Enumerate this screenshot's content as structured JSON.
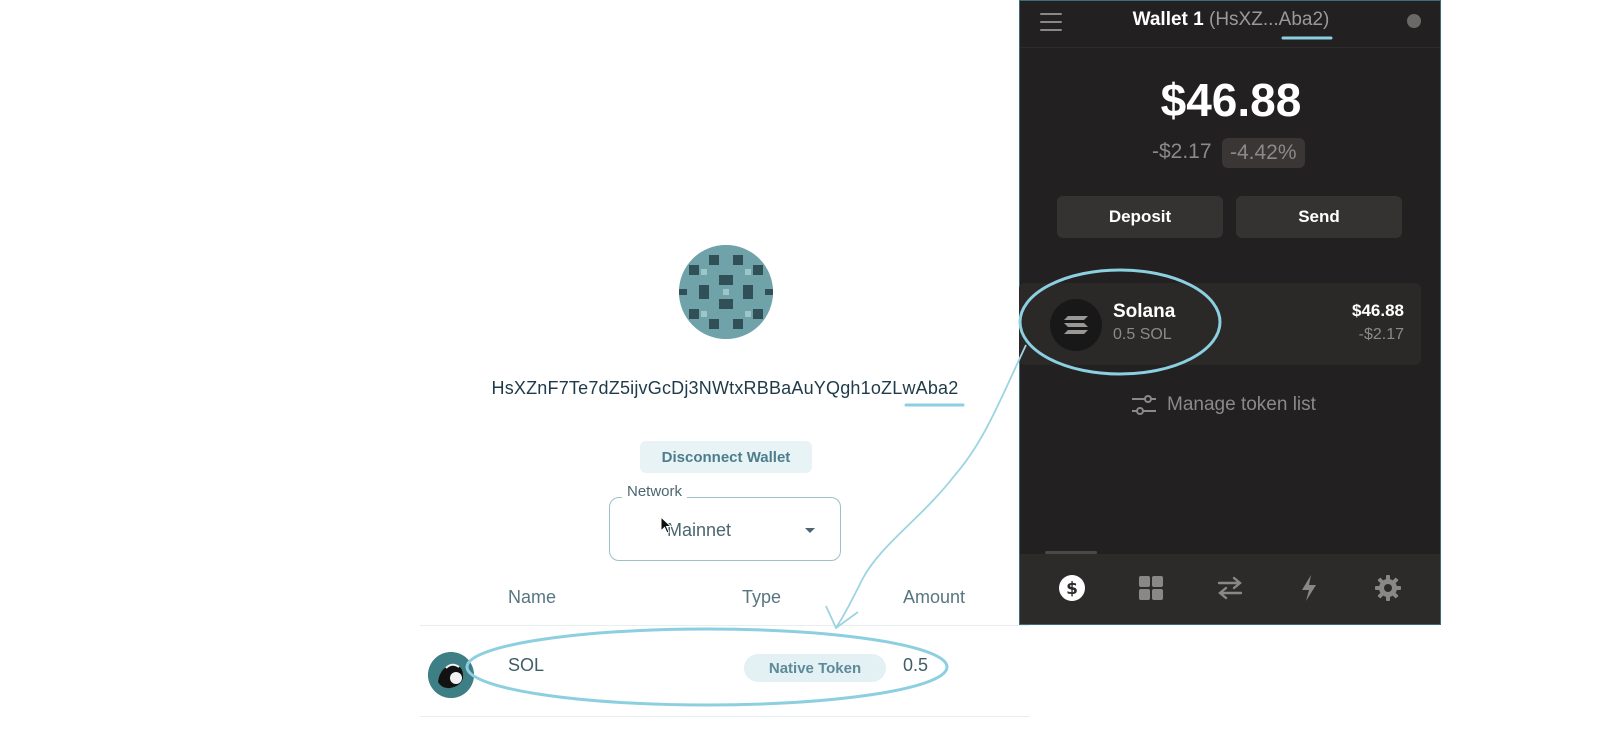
{
  "dapp": {
    "address": "HsXZnF7Te7dZ5ijvGcDj3NWtxRBBaAuYQgh1oZLwAba2",
    "disconnect_label": "Disconnect Wallet",
    "network": {
      "label": "Network",
      "selected": "Mainnet"
    },
    "table": {
      "headers": [
        "Name",
        "Type",
        "Amount"
      ],
      "rows": [
        {
          "name": "SOL",
          "type": "Native Token",
          "amount": "0.5"
        }
      ]
    }
  },
  "wallet": {
    "title": "Wallet 1",
    "title_short_address": "(HsXZ...Aba2)",
    "balance": "$46.88",
    "change_usd": "-$2.17",
    "change_pct": "-4.42%",
    "buttons": {
      "deposit": "Deposit",
      "send": "Send"
    },
    "tokens": [
      {
        "name": "Solana",
        "amount": "0.5 SOL",
        "usd": "$46.88",
        "change": "-$2.17"
      }
    ],
    "manage_label": "Manage token list",
    "nav": [
      "dollar-icon",
      "grid-icon",
      "swap-icon",
      "lightning-icon",
      "gear-icon"
    ]
  },
  "colors": {
    "annotation": "#8ccfe0",
    "wallet_bg": "#222020",
    "accent_text": "#4d7d8c"
  }
}
